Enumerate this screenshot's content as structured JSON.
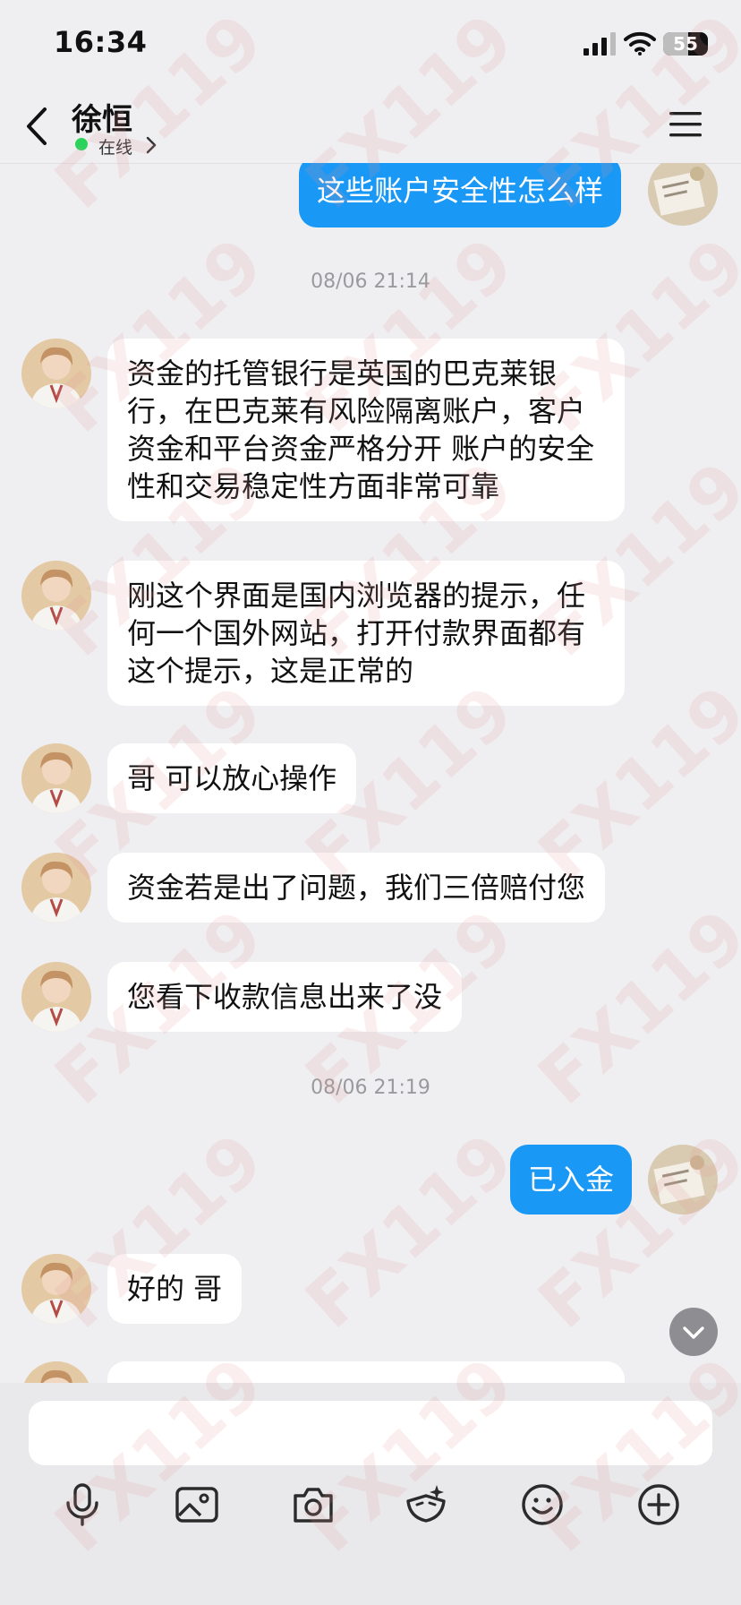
{
  "status_bar": {
    "time": "16:34",
    "battery_text": "55",
    "battery_level": 0.55
  },
  "header": {
    "contact_name": "徐恒",
    "status": "在线"
  },
  "messages": [
    {
      "side": "out",
      "text": "这些账户安全性怎么样"
    },
    {
      "type": "time",
      "text": "08/06 21:14"
    },
    {
      "side": "in",
      "text": "资金的托管银行是英国的巴克莱银行，在巴克莱有风险隔离账户，客户资金和平台资金严格分开  账户的安全性和交易稳定性方面非常可靠"
    },
    {
      "side": "in",
      "text": "刚这个界面是国内浏览器的提示，任何一个国外网站，打开付款界面都有这个提示，这是正常的"
    },
    {
      "side": "in",
      "text": "哥 可以放心操作"
    },
    {
      "side": "in",
      "text": "资金若是出了问题，我们三倍赔付您"
    },
    {
      "side": "in",
      "text": "您看下收款信息出来了没"
    },
    {
      "type": "time",
      "text": "08/06 21:19"
    },
    {
      "side": "out",
      "text": "已入金"
    },
    {
      "side": "in",
      "text": "好的 哥"
    }
  ],
  "input": {
    "value": "",
    "placeholder": ""
  },
  "toolbar": {
    "icons": [
      "microphone-icon",
      "image-icon",
      "camera-icon",
      "sticker-icon",
      "emoji-icon",
      "plus-icon"
    ]
  },
  "watermark": "FX119",
  "colors": {
    "bubble_out": "#1a98f6",
    "bubble_in": "#ffffff",
    "online": "#2bd35b",
    "background": "#efeff1"
  }
}
